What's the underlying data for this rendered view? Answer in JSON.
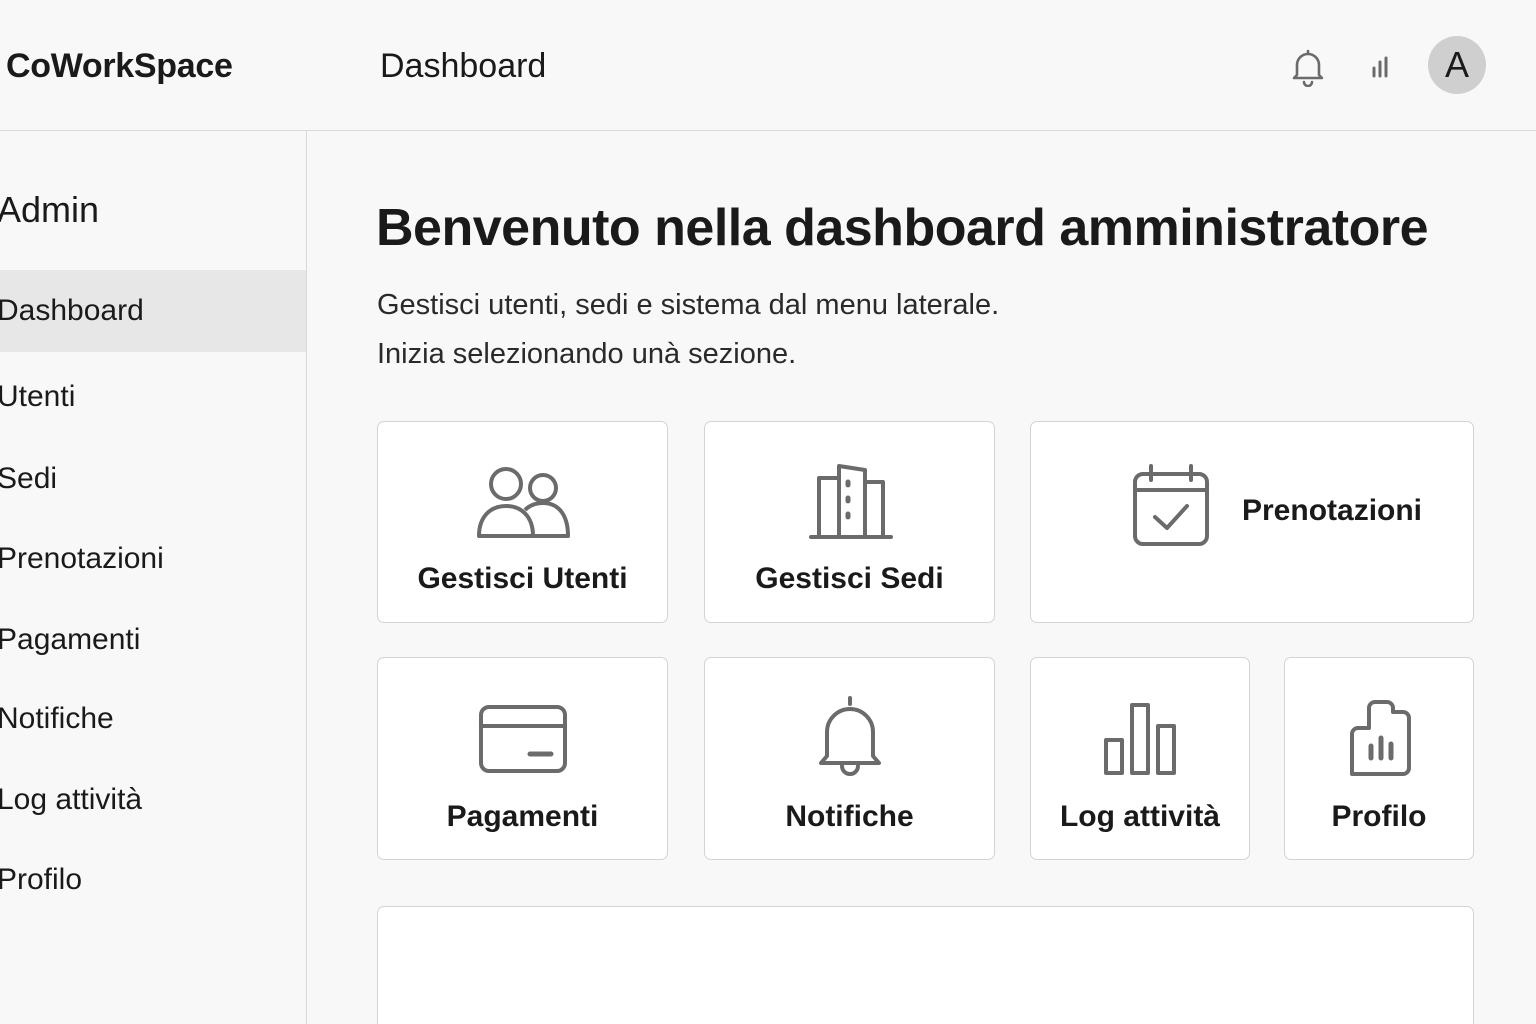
{
  "header": {
    "brand": "CoWorkSpace",
    "title": "Dashboard",
    "avatar_initial": "A"
  },
  "sidebar": {
    "heading": "Admin",
    "items": [
      {
        "label": "Dashboard",
        "active": true
      },
      {
        "label": "Utenti"
      },
      {
        "label": "Sedi"
      },
      {
        "label": "Prenotazioni"
      },
      {
        "label": "Pagamenti"
      },
      {
        "label": "Notifiche"
      },
      {
        "label": "Log attività"
      },
      {
        "label": "Profilo"
      }
    ]
  },
  "main": {
    "title": "Benvenuto nella dashboard amministratore",
    "subtitle_line1": "Gestisci utenti, sedi e sistema dal menu laterale.",
    "subtitle_line2": "Inizia selezionando unà sezione.",
    "cards": [
      {
        "label": "Gestisci Utenti",
        "icon": "users-icon"
      },
      {
        "label": "Gestisci Sedi",
        "icon": "building-icon"
      },
      {
        "label": "Prenotazioni",
        "icon": "calendar-check-icon"
      },
      {
        "label": "Pagamenti",
        "icon": "credit-card-icon"
      },
      {
        "label": "Notifiche",
        "icon": "bell-icon"
      },
      {
        "label": "Log attività",
        "icon": "bar-chart-icon"
      },
      {
        "label": "Profilo",
        "icon": "profile-chart-icon"
      }
    ]
  },
  "colors": {
    "background": "#f8f8f8",
    "card": "#ffffff",
    "border": "#d4d4d4",
    "icon": "#6b6b6b",
    "active_nav": "#e7e7e7"
  }
}
